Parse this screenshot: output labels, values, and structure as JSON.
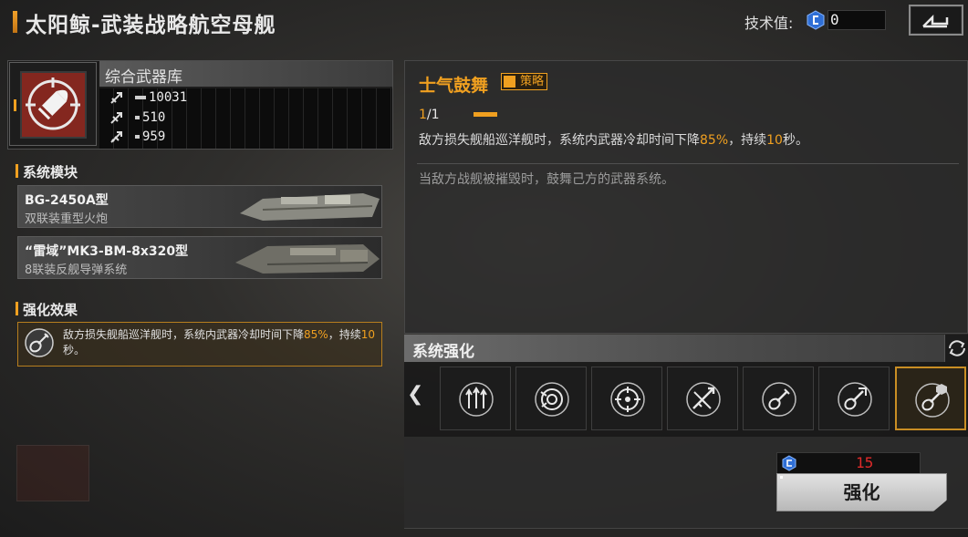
{
  "header": {
    "title": "太阳鲸-武装战略航空母舰",
    "tech_label": "技术值:",
    "tech_value": "0",
    "back_icon": "return-icon"
  },
  "weapon": {
    "icon": "shell-icon",
    "name": "综合武器库",
    "stats": [
      {
        "icon": "damage-icon",
        "value": "10031"
      },
      {
        "icon": "fire-rate-icon",
        "value": "510"
      },
      {
        "icon": "range-icon",
        "value": "959"
      }
    ]
  },
  "system_modules": {
    "label": "系统模块",
    "items": [
      {
        "title": "BG-2450A型",
        "subtitle": "双联装重型火炮"
      },
      {
        "title": "“雷域”MK3-BM-8x320型",
        "subtitle": "8联装反舰导弹系统"
      }
    ]
  },
  "enhance_effect": {
    "label": "强化效果",
    "text_before": "敌方损失舰船巡洋舰时，系统内武器冷却时间下降",
    "pct": "85%",
    "text_mid": "，持续",
    "dur": "10",
    "text_after": "秒。"
  },
  "skill": {
    "title": "士气鼓舞",
    "tag": "策略",
    "level_current": "1",
    "level_max": "/1",
    "desc_before": "敌方损失舰船巡洋舰时，系统内武器冷却时间下降",
    "desc_pct": "85%",
    "desc_mid": "，持续",
    "desc_dur": "10",
    "desc_after": "秒。",
    "condition": "当敌方战舰被摧毁时，鼓舞己方的武器系统。"
  },
  "system_enhance": {
    "title": "系统强化",
    "slots": [
      "triple-arrow-icon",
      "radar-sweep-icon",
      "crosshair-icon",
      "missile-cross-icon",
      "guitar-icon",
      "guitar-rocket-icon",
      "guitar-upgrade-icon"
    ],
    "selected_index": 6
  },
  "enhance_action": {
    "cost": "15",
    "button_label": "强化"
  },
  "colors": {
    "accent": "#f0a020",
    "cost_red": "#e02a2a",
    "weapon_icon_bg": "#84271f"
  }
}
